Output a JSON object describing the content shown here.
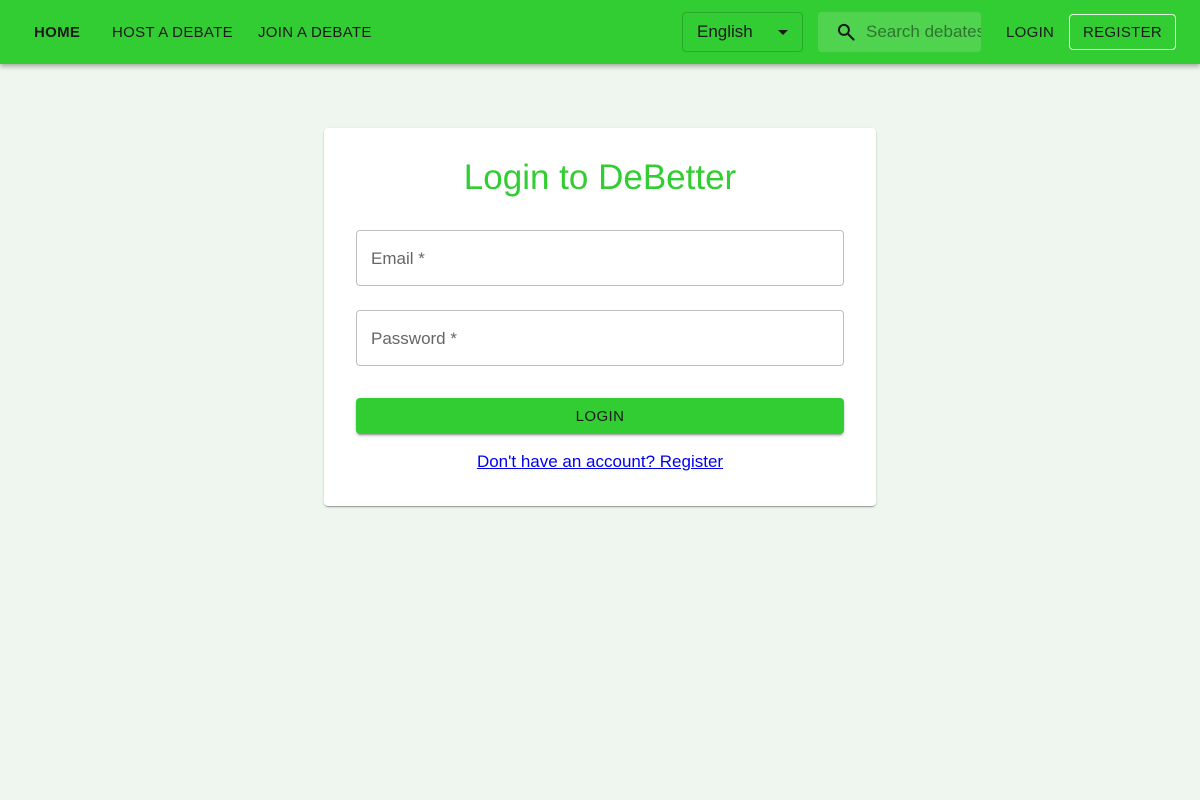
{
  "nav": {
    "home": "HOME",
    "host": "HOST A DEBATE",
    "join": "JOIN A DEBATE",
    "language": "English",
    "search_placeholder": "Search debates",
    "login": "LOGIN",
    "register": "REGISTER"
  },
  "icons": {
    "search": "search-icon",
    "dropdown": "arrow-drop-down-icon"
  },
  "colors": {
    "brand": "#32cd32",
    "background": "#eff6ef",
    "link": "#0000ee"
  },
  "form": {
    "title": "Login to DeBetter",
    "email_label": "Email *",
    "email_value": "",
    "password_label": "Password *",
    "password_value": "",
    "submit_label": "LOGIN",
    "register_link": "Don't have an account? Register"
  }
}
